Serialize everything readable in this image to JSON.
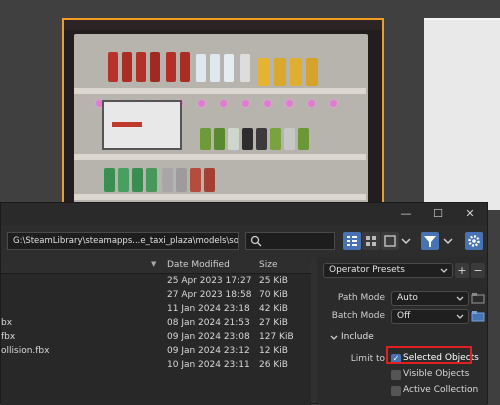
{
  "dialog": {
    "path": "G:\\SteamLibrary\\steamapps...e_taxi_plaza\\models\\source\\",
    "controls": {
      "minimize": "—",
      "maximize": "☐",
      "close": "✕"
    }
  },
  "columns": {
    "date": "Date Modified",
    "size": "Size"
  },
  "files": [
    {
      "name": "",
      "date": "25 Apr 2023 17:27",
      "size": "25 KiB"
    },
    {
      "name": "",
      "date": "27 Apr 2023 18:58",
      "size": "70 KiB"
    },
    {
      "name": "",
      "date": "11 Jan 2024 23:18",
      "size": "42 KiB"
    },
    {
      "name": "bx",
      "date": "08 Jan 2024 21:53",
      "size": "27 KiB"
    },
    {
      "name": "fbx",
      "date": "09 Jan 2024 23:08",
      "size": "127 KiB"
    },
    {
      "name": "ollision.fbx",
      "date": "09 Jan 2024 23:12",
      "size": "12 KiB"
    },
    {
      "name": "",
      "date": "10 Jan 2024 23:11",
      "size": "26 KiB"
    }
  ],
  "panel": {
    "operator_presets": "Operator Presets",
    "path_mode_label": "Path Mode",
    "path_mode_value": "Auto",
    "batch_mode_label": "Batch Mode",
    "batch_mode_value": "Off",
    "include_label": "Include",
    "limit_to_label": "Limit to",
    "options": [
      {
        "label": "Selected Objects",
        "checked": true
      },
      {
        "label": "Visible Objects",
        "checked": false
      },
      {
        "label": "Active Collection",
        "checked": false
      }
    ]
  },
  "icons": {
    "search": "search-icon",
    "filter": "filter-icon",
    "settings": "gear-icon",
    "add": "+",
    "remove": "−"
  },
  "colors": {
    "accent": "#4772b3",
    "highlight": "#e02020",
    "selection_outline": "#f39c1f"
  }
}
